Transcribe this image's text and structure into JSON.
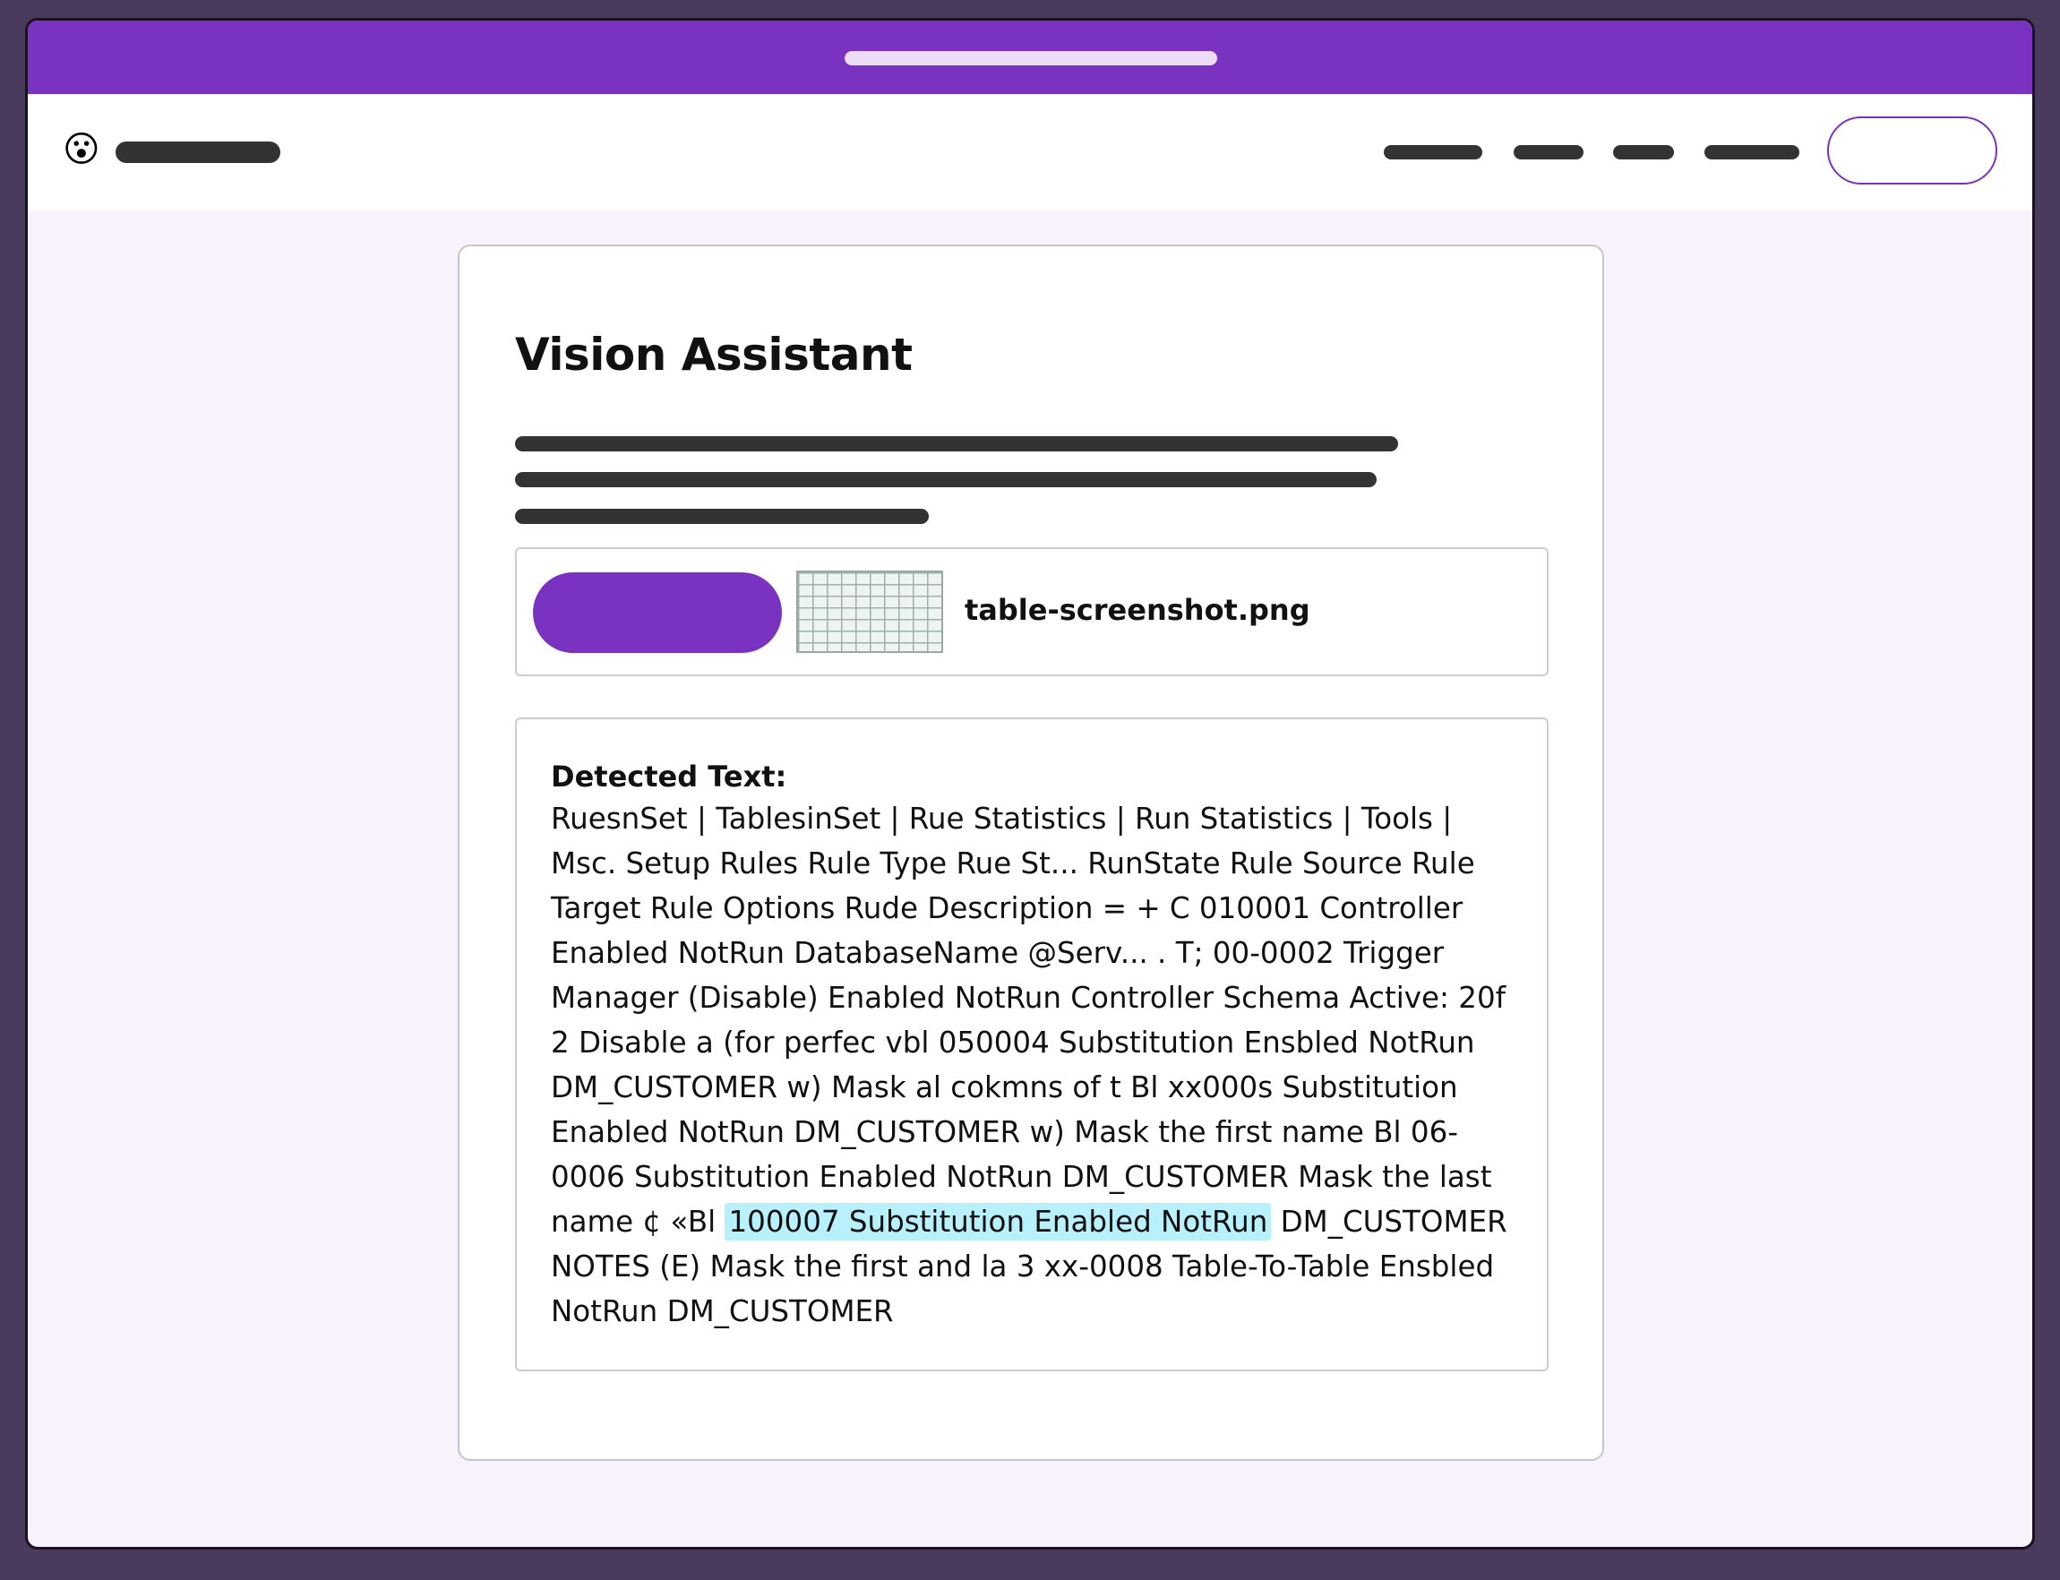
{
  "app": {
    "logo_icon": "😮"
  },
  "page": {
    "title": "Vision Assistant"
  },
  "upload": {
    "file_name": "table-screenshot.png"
  },
  "result": {
    "heading": "Detected Text:",
    "text_before": "RuesnSet | TablesinSet | Rue Statistics | Run Statistics | Tools | Msc. Setup Rules Rule Type Rue St... RunState Rule Source Rule Target Rule Options Rude Description = + C 010001 Controller Enabled NotRun DatabaseName @Serv... . T; 00-0002 Trigger Manager (Disable) Enabled NotRun Controller Schema Active: 20f 2 Disable a (for perfec vbl 050004 Substitution Ensbled NotRun DM_CUSTOMER w) Mask al cokmns of t Bl xx000s Substitution Enabled NotRun DM_CUSTOMER w) Mask the first name Bl 06-0006 Substitution Enabled NotRun DM_CUSTOMER Mask the last name ¢ «Bl ",
    "text_highlight": "100007 Substitution Enabled NotRun",
    "text_after": " DM_CUSTOMER NOTES (E) Mask the first and la 3 xx-0008 Table-To-Table Ensbled NotRun DM_CUSTOMER",
    "highlight_color": "#b8f0fb"
  },
  "colors": {
    "accent": "#7a32c0",
    "background": "#f8f2fd"
  }
}
